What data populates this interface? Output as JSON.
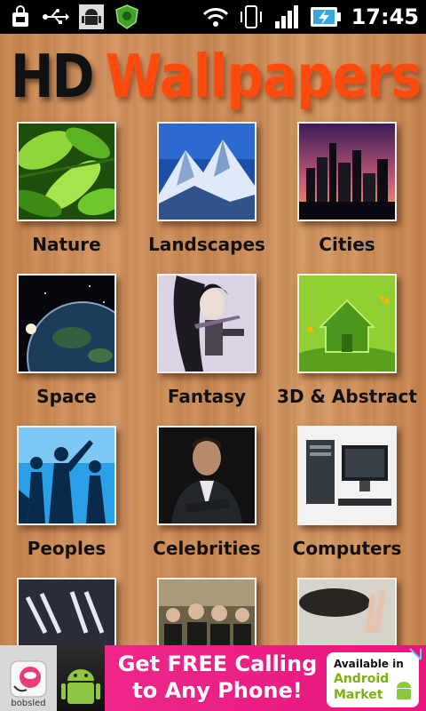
{
  "status_bar": {
    "time": "17:45",
    "icons": [
      "bag-icon",
      "usb-icon",
      "android-debug-icon",
      "shield-app-icon",
      "wifi-icon",
      "vibrate-icon",
      "signal-icon",
      "battery-charging-icon"
    ]
  },
  "title": {
    "part1": "HD",
    "part2": "Wallpapers"
  },
  "categories": [
    {
      "label": "Nature"
    },
    {
      "label": "Landscapes"
    },
    {
      "label": "Cities"
    },
    {
      "label": "Space"
    },
    {
      "label": "Fantasy"
    },
    {
      "label": "3D & Abstract"
    },
    {
      "label": "Peoples"
    },
    {
      "label": "Celebrities"
    },
    {
      "label": "Computers"
    },
    {
      "label": ""
    },
    {
      "label": ""
    },
    {
      "label": ""
    }
  ],
  "ad": {
    "brand": "bobsled",
    "headline_line1": "Get FREE Calling",
    "headline_line2": "to Any Phone!",
    "market_line1": "Available in",
    "market_line2": "Android",
    "market_line3": "Market",
    "colors": {
      "background": "#e8157d",
      "market_green": "#7cb10f"
    }
  },
  "colors": {
    "title_hd": "#111111",
    "title_wallpapers": "#ff4a0e",
    "wood": "#c98a56"
  }
}
